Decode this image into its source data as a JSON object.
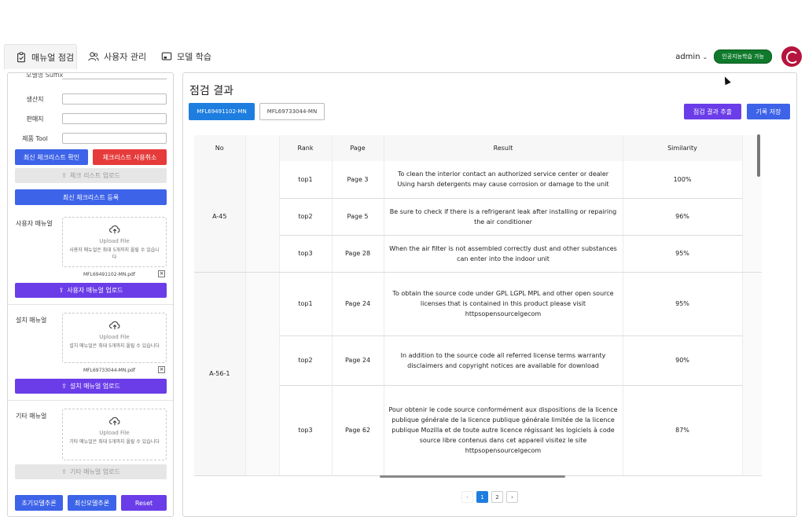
{
  "nav": {
    "tabs": [
      {
        "label": "매뉴얼 점검",
        "icon": "clipboard-check-icon"
      },
      {
        "label": "사용자 관리",
        "icon": "users-icon"
      },
      {
        "label": "모델 학습",
        "icon": "monitor-icon"
      }
    ],
    "user": "admin",
    "ai_status": "인공지능학습 가능"
  },
  "left": {
    "top_label": "모델명 Suffix",
    "fields": [
      {
        "label": "생산지",
        "value": ""
      },
      {
        "label": "판매지",
        "value": ""
      },
      {
        "label": "제품 Tool",
        "value": ""
      }
    ],
    "btn_check_latest": "최신 체크리스트 확인",
    "btn_cancel_checklist": "체크리스트 사용취소",
    "btn_upload_checklist": "체크 리스트 업로드",
    "btn_register_checklist": "최신 체크리스트 등록",
    "user_manual": {
      "label": "사용자 매뉴얼",
      "upload_title": "Upload File",
      "upload_desc": "사용자 매뉴얼은 최대 5개까지 올릴 수 있습니다",
      "file": "MFL69491102-MN.pdf",
      "btn": "사용자 매뉴얼 업로드"
    },
    "install_manual": {
      "label": "설치 매뉴얼",
      "upload_title": "Upload File",
      "upload_desc": "설치 매뉴얼은 최대 5개까지 올릴 수 있습니다",
      "file": "MFL69733044-MN.pdf",
      "btn": "설치 매뉴얼 업로드"
    },
    "other_manual": {
      "label": "기타 매뉴얼",
      "upload_title": "Upload File",
      "upload_desc": "기타 매뉴얼은 최대 5개까지 올릴 수 있습니다",
      "btn": "기타 매뉴얼 업로드"
    },
    "btn_initial_model": "초기모델추론",
    "btn_latest_model": "최신모델추론",
    "btn_reset": "Reset"
  },
  "right": {
    "title": "점검 결과",
    "manual_tabs": [
      "MFL69491102-MN",
      "MFL69733044-MN"
    ],
    "btn_export": "점검 결과 추출",
    "btn_save": "기록 저장",
    "columns": [
      "No",
      "Rank",
      "Page",
      "Result",
      "Similarity"
    ],
    "groups": [
      {
        "no": "A-45",
        "rows": [
          {
            "rank": "top1",
            "page": "Page 3",
            "result": "To clean the interior contact an authorized service center or dealer Using harsh detergents may cause corrosion or damage to the unit",
            "similarity": "100%"
          },
          {
            "rank": "top2",
            "page": "Page 5",
            "result": "Be sure to check if there is a refrigerant leak after installing or repairing the air conditioner",
            "similarity": "96%"
          },
          {
            "rank": "top3",
            "page": "Page 28",
            "result": "When the air filter is not assembled correctly dust and other substances can enter into the indoor unit",
            "similarity": "95%"
          }
        ]
      },
      {
        "no": "A-56-1",
        "rows": [
          {
            "rank": "top1",
            "page": "Page 24",
            "result": "To obtain the source code under GPL LGPL MPL and other open source licenses that is contained in this product please visit httpsopensourcelgecom",
            "similarity": "95%"
          },
          {
            "rank": "top2",
            "page": "Page 24",
            "result": "In addition to the source code all referred license terms warranty disclaimers and copyright notices are available for download",
            "similarity": "90%"
          },
          {
            "rank": "top3",
            "page": "Page 62",
            "result": "Pour obtenir le code source conformément aux dispositions de la licence publique générale de la licence publique générale limitée de la licence publique Mozilla et de toute autre licence régissant les logiciels à code source libre contenus dans cet appareil visitez le site httpsopensourcelgecom",
            "similarity": "87%"
          }
        ]
      }
    ],
    "pagination": {
      "prev": "‹",
      "pages": [
        "1",
        "2"
      ],
      "next": "›",
      "current": "1"
    }
  }
}
